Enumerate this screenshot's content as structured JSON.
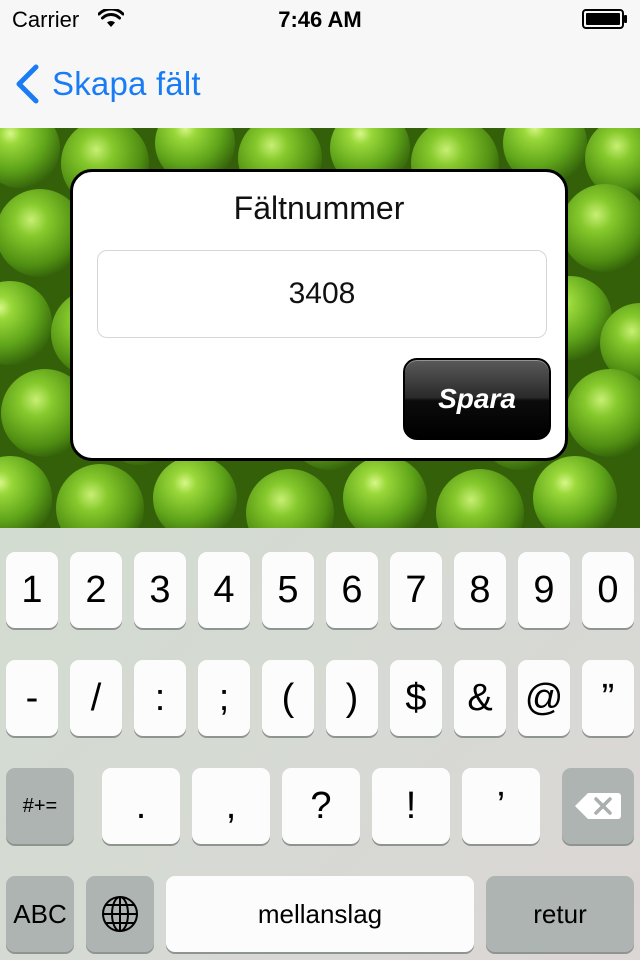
{
  "status_bar": {
    "carrier": "Carrier",
    "time": "7:46 AM",
    "wifi_icon": "wifi-icon",
    "battery_icon": "battery-icon"
  },
  "nav_bar": {
    "back_label": "Skapa fält",
    "back_icon": "chevron-left-icon",
    "accent_color": "#1a7cf5"
  },
  "background": {
    "description_icon": "peas-image"
  },
  "dialog": {
    "title": "Fältnummer",
    "field_value": "3408",
    "save_label": "Spara"
  },
  "keyboard": {
    "row1": [
      "1",
      "2",
      "3",
      "4",
      "5",
      "6",
      "7",
      "8",
      "9",
      "0"
    ],
    "row2": [
      "-",
      "/",
      ":",
      ";",
      "(",
      ")",
      "$",
      "&",
      "@",
      "”"
    ],
    "row3": {
      "shift_label": "#+=",
      "keys": [
        ".",
        ",",
        "?",
        "!",
        "’"
      ],
      "delete_icon": "backspace-icon"
    },
    "row4": {
      "abc_label": "ABC",
      "globe_icon": "globe-icon",
      "space_label": "mellanslag",
      "return_label": "retur"
    }
  }
}
